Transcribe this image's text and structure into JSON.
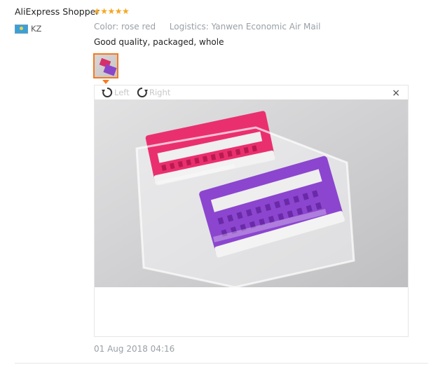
{
  "reviewer": {
    "name": "AliExpress Shopper",
    "rating_stars": "★★★★★",
    "rating": 5,
    "country_code": "KZ"
  },
  "attributes": {
    "color_label": "Color:",
    "color_value": "rose red",
    "logistics_label": "Logistics:",
    "logistics_value": "Yanwen Economic Air Mail"
  },
  "review": {
    "text": "Good quality, packaged, whole",
    "date": "01 Aug 2018 04:16"
  },
  "viewer": {
    "rotate_left_label": "Left",
    "rotate_right_label": "Right",
    "close_symbol": "×"
  },
  "colors": {
    "star": "#f6a623",
    "accent": "#f47a20",
    "muted": "#9aa0a6"
  }
}
